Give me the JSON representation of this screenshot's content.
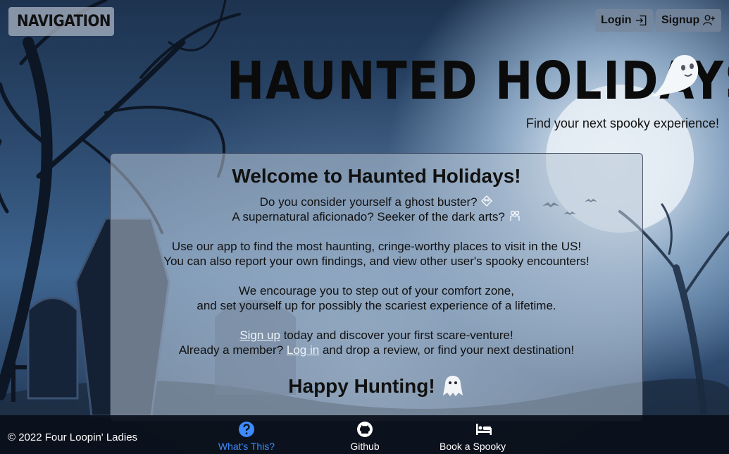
{
  "nav": {
    "brand": "NAVIGATION",
    "brand_icon": "ghost-icon"
  },
  "auth": {
    "login": "Login",
    "signup": "Signup"
  },
  "hero": {
    "title": "HAUNTED HOLIDAYS",
    "tagline": "Find your next spooky experience!"
  },
  "card": {
    "heading": "Welcome to Haunted Holidays!",
    "line1": "Do you consider yourself a ghost buster?",
    "line2": "A supernatural aficionado? Seeker of the dark arts?",
    "line3": "Use our app to find the most haunting, cringe-worthy places to visit in the US!",
    "line4": "You can also report your own findings, and view other user's spooky encounters!",
    "line5": "We encourage you to step out of your comfort zone,",
    "line6": "and set yourself up for possibly the scariest experience of a lifetime.",
    "signup_link": "Sign up",
    "line7_rest": " today and discover your first scare-venture!",
    "line8_pre": "Already a member? ",
    "login_link": "Log in",
    "line8_rest": " and drop a review, or find your next destination!",
    "closing": "Happy Hunting!"
  },
  "footer": {
    "copyright": "© 2022 Four Loopin' Ladies",
    "links": [
      {
        "label": "What's This?",
        "icon": "question-circle-icon",
        "active": true
      },
      {
        "label": "Github",
        "icon": "github-icon"
      },
      {
        "label": "Book a Spooky Stay",
        "icon": "bed-icon"
      }
    ]
  },
  "colors": {
    "accent": "#3d8bfd",
    "footer_bg": "#0a0f19"
  }
}
